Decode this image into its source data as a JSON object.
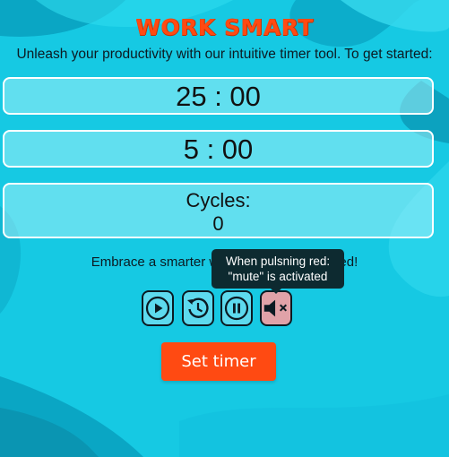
{
  "app": {
    "title": "WORK SMART",
    "subtitle": "Unleash your productivity with our intuitive timer tool. To get started:"
  },
  "timers": {
    "work": "25 : 00",
    "break": "5 : 00",
    "cycles_label": "Cycles:",
    "cycles_value": "0"
  },
  "tagline": "Embrace a smarter way to work. Get started!",
  "tooltip": {
    "line1": "When pulsning red:",
    "line2": "\"mute\" is activated"
  },
  "controls": [
    {
      "name": "play",
      "icon": "play-icon"
    },
    {
      "name": "reset",
      "icon": "reset-icon"
    },
    {
      "name": "pause",
      "icon": "pause-icon"
    },
    {
      "name": "mute",
      "icon": "mute-icon"
    }
  ],
  "set_button_label": "Set timer",
  "colors": {
    "accent": "#ff4a12",
    "background": "#16c9e3",
    "mute_button": "#e0a2a8",
    "tooltip_bg": "#0d2a30"
  }
}
